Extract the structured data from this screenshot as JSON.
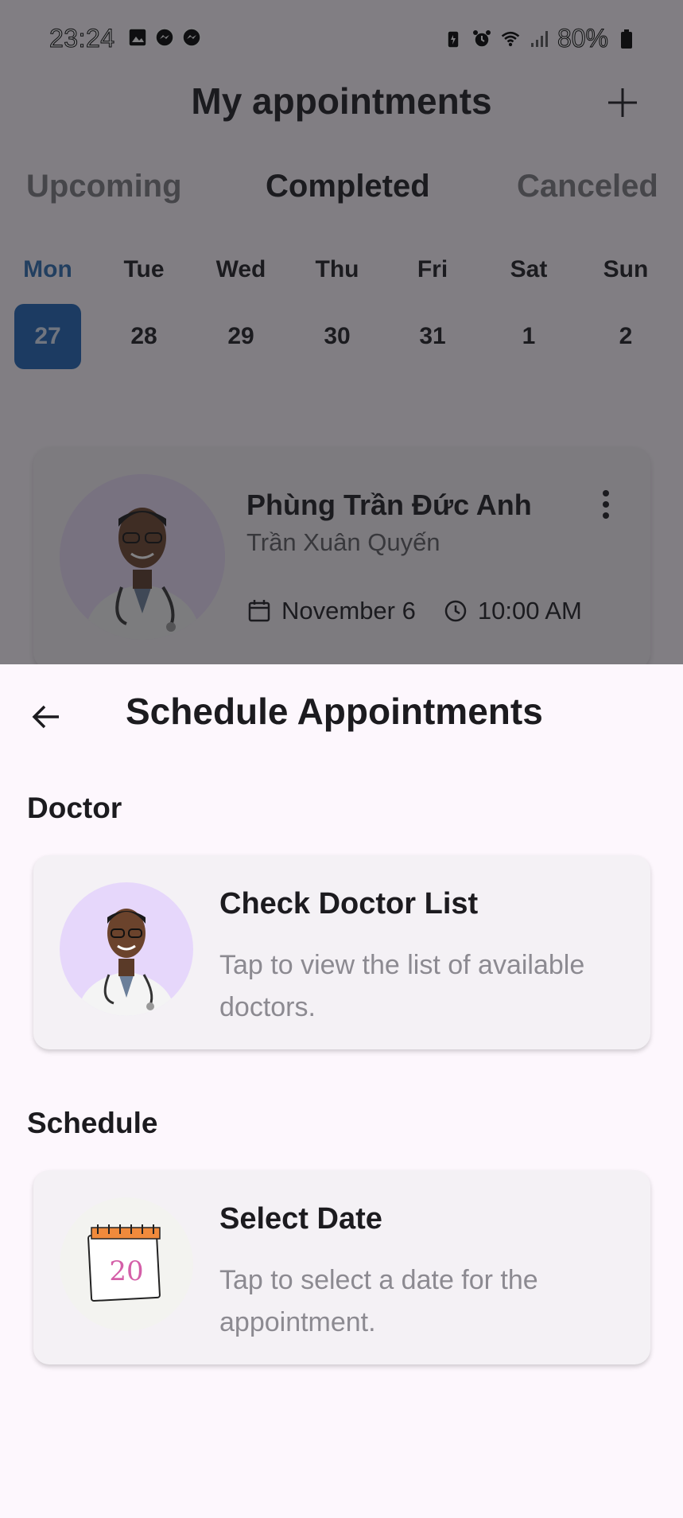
{
  "status_bar": {
    "time": "23:24",
    "battery": "80%",
    "left_icons": [
      "image-icon",
      "messenger-icon",
      "messenger-icon"
    ],
    "right_icons": [
      "battery-saver-icon",
      "alarm-icon",
      "wifi-icon",
      "signal-icon",
      "battery-icon"
    ]
  },
  "background": {
    "title": "My appointments",
    "tabs": [
      "Upcoming",
      "Completed",
      "Canceled"
    ],
    "active_tab": "Completed",
    "week": [
      {
        "day": "Mon",
        "date": "27"
      },
      {
        "day": "Tue",
        "date": "28"
      },
      {
        "day": "Wed",
        "date": "29"
      },
      {
        "day": "Thu",
        "date": "30"
      },
      {
        "day": "Fri",
        "date": "31"
      },
      {
        "day": "Sat",
        "date": "1"
      },
      {
        "day": "Sun",
        "date": "2"
      }
    ],
    "selected_day": "Mon",
    "appointment": {
      "doctor_name": "Phùng Trần Đức Anh",
      "patient_name": "Trần Xuân Quyến",
      "date": "November 6",
      "time": "10:00 AM"
    }
  },
  "sheet": {
    "title": "Schedule Appointments",
    "doctor_section": "Doctor",
    "doctor_card": {
      "title": "Check Doctor List",
      "description": "Tap to view the list of available doctors."
    },
    "schedule_section": "Schedule",
    "date_card": {
      "title": "Select Date",
      "description": "Tap to select a date for the appointment.",
      "calendar_day": "20"
    }
  },
  "colors": {
    "accent": "#1e63b3",
    "selected_day_text": "#2b6cb0",
    "sheet_bg": "#fdf7fd",
    "card_bg": "#f4f1f5",
    "muted_text": "#8c8a91"
  }
}
